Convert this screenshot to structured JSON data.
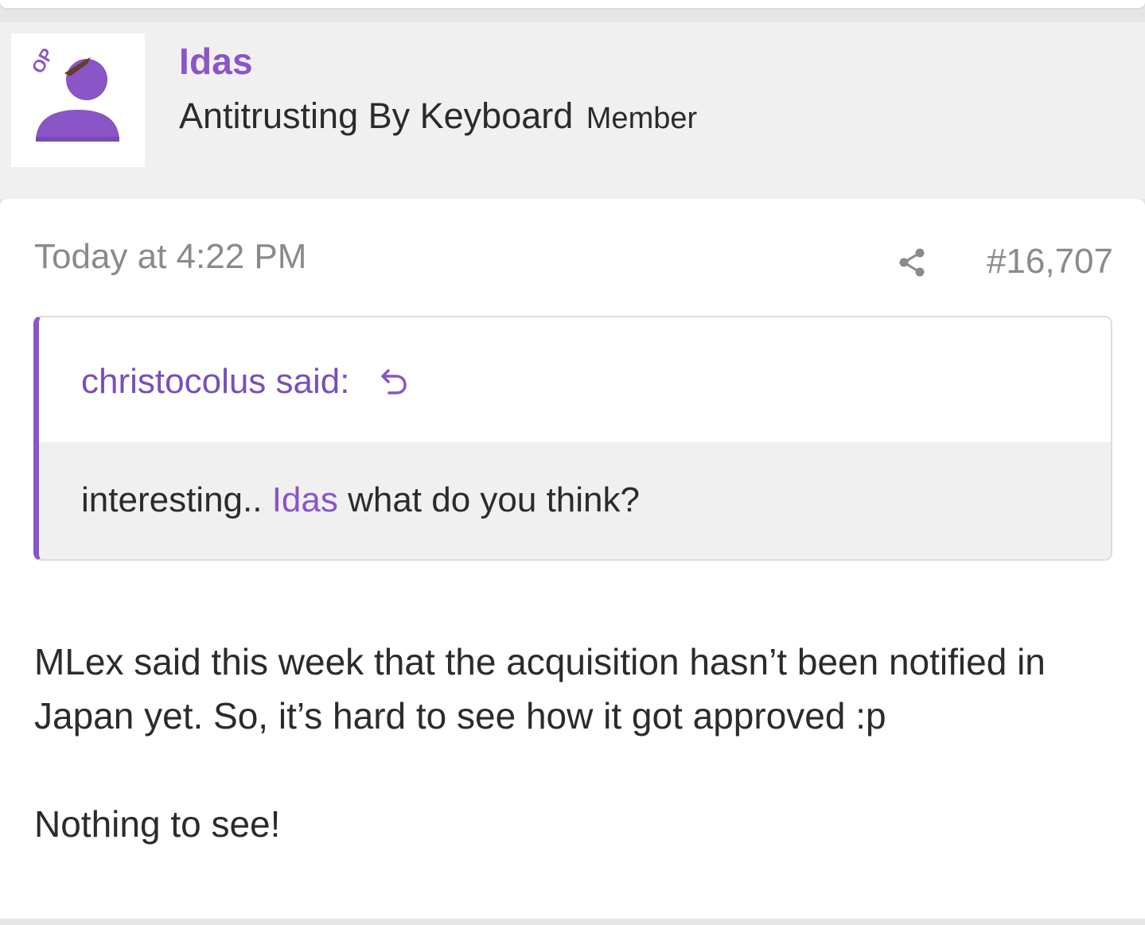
{
  "user": {
    "name": "Idas",
    "title": "Antitrusting By Keyboard",
    "role": "Member",
    "badge": "OP"
  },
  "post": {
    "date": "Today at 4:22 PM",
    "number": "#16,707",
    "quote": {
      "author_line": "christocolus said:",
      "text_before": "interesting.. ",
      "mention": "Idas",
      "text_after": " what do you think?"
    },
    "paragraphs": [
      "MLex said this week that the acquisition hasn’t been notified in Japan yet. So, it’s hard to see how it got approved :p",
      "Nothing to see!"
    ]
  },
  "icons": {
    "share": "share-icon",
    "quote_jump": "arrow-return-icon",
    "avatar": "user-silhouette-icon"
  },
  "colors": {
    "accent": "#8a55c6",
    "header_bg": "#f0f0f0",
    "muted_text": "#8a8a8a"
  }
}
